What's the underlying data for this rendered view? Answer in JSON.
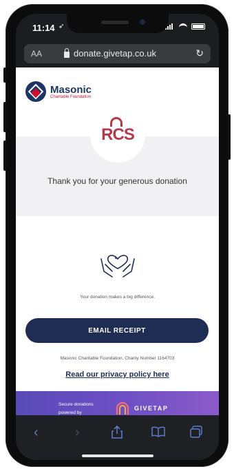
{
  "status": {
    "time": "11:14"
  },
  "browser": {
    "text_size_label": "AA",
    "url": "donate.givetap.co.uk"
  },
  "page": {
    "logo": {
      "name": "Masonic",
      "subtitle": "Charitable Foundation"
    },
    "rcs_label": "RCS",
    "thanks": "Thank you for your generous donation",
    "difference": "Your donation makes a big difference.",
    "email_button": "EMAIL RECEIPT",
    "charity_number": "Masonic Charitable Foundation. Charity Number 1164703",
    "privacy_link": "Read our privacy policy here",
    "footer": {
      "secure_line1": "Secure donations",
      "secure_line2": "powered by",
      "brand": "GIVETAP"
    }
  },
  "toolbar": {
    "icons": [
      "back-icon",
      "forward-icon",
      "share-icon",
      "bookmarks-icon",
      "tabs-icon"
    ]
  }
}
